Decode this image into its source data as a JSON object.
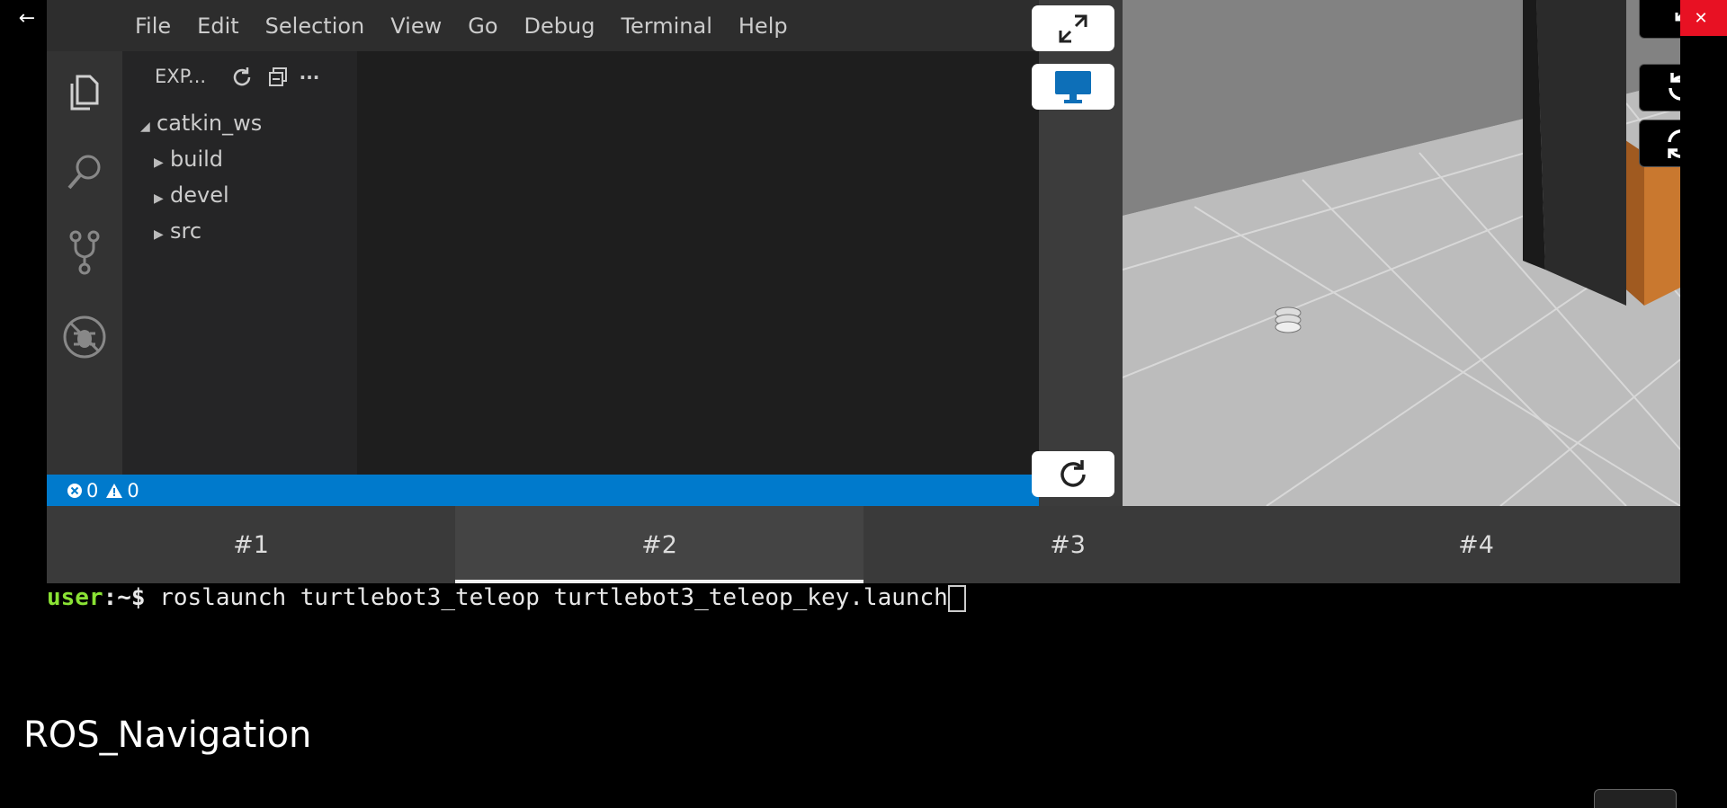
{
  "window": {
    "back_label": "←",
    "minimize_label": "—",
    "maximize_label": "❐",
    "close_label": "✕",
    "close_color": "#e81123"
  },
  "vscode": {
    "menu": [
      "File",
      "Edit",
      "Selection",
      "View",
      "Go",
      "Debug",
      "Terminal",
      "Help"
    ],
    "activity_icons": [
      "explorer-icon",
      "search-icon",
      "source-control-icon",
      "debug-icon"
    ],
    "sidebar": {
      "title": "EXP...",
      "actions": [
        "refresh-icon",
        "collapse-all-icon",
        "more-icon"
      ],
      "more_label": "···",
      "root": "catkin_ws",
      "folders": [
        "build",
        "devel",
        "src"
      ]
    },
    "status": {
      "errors": "0",
      "warnings": "0",
      "bar_color": "#007acc"
    }
  },
  "controls": {
    "fullscreen_icon": "expand-icon",
    "desktop_icon": "monitor-icon",
    "reload_icon": "reload-icon"
  },
  "sim": {
    "buttons": [
      "collapse-icon",
      "reset-view-icon",
      "reset-world-icon"
    ]
  },
  "tabs": [
    "#1",
    "#2",
    "#3",
    "#4"
  ],
  "active_tab": "#2",
  "terminal": {
    "user": "user",
    "prompt_suffix": ":~$ ",
    "command": "roslaunch turtlebot3_teleop turtlebot3_teleop_key.launch"
  },
  "video_title": "ROS_Navigation"
}
